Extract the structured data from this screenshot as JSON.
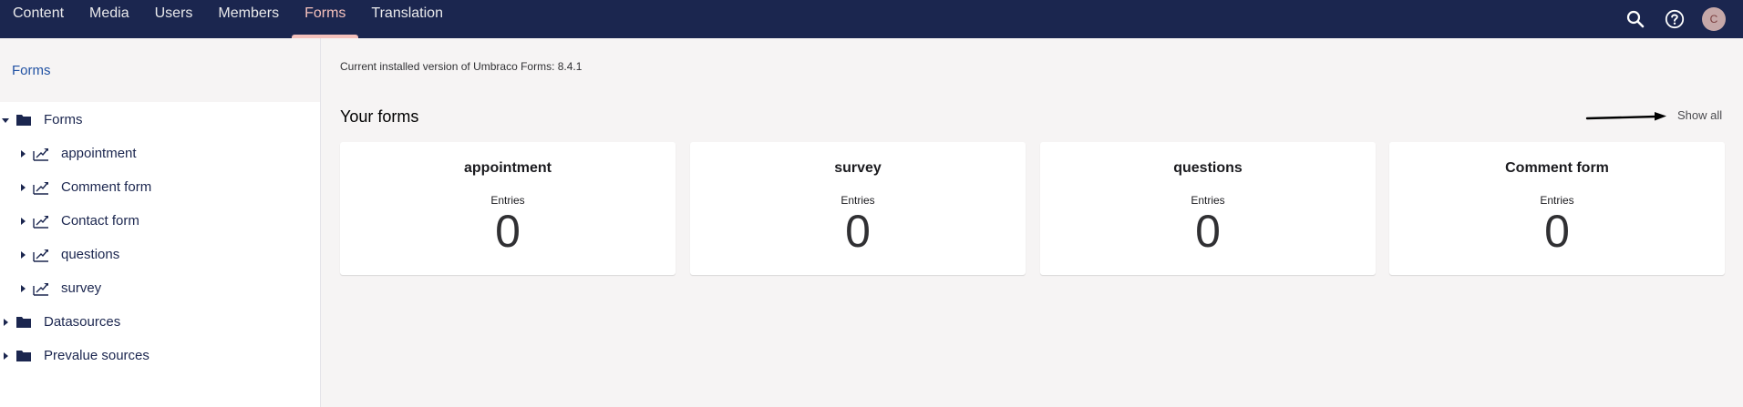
{
  "nav": {
    "items": [
      {
        "label": "Content",
        "active": false
      },
      {
        "label": "Media",
        "active": false
      },
      {
        "label": "Users",
        "active": false
      },
      {
        "label": "Members",
        "active": false
      },
      {
        "label": "Forms",
        "active": true
      },
      {
        "label": "Translation",
        "active": false
      }
    ],
    "avatar_initial": "C",
    "icons": [
      "search-icon",
      "help-icon"
    ]
  },
  "sidebar": {
    "title": "Forms",
    "tree": [
      {
        "label": "Forms",
        "icon": "folder-icon",
        "expanded": true,
        "level": 0
      },
      {
        "label": "appointment",
        "icon": "form-icon",
        "expanded": false,
        "level": 1
      },
      {
        "label": "Comment form",
        "icon": "form-icon",
        "expanded": false,
        "level": 1
      },
      {
        "label": "Contact form",
        "icon": "form-icon",
        "expanded": false,
        "level": 1
      },
      {
        "label": "questions",
        "icon": "form-icon",
        "expanded": false,
        "level": 1
      },
      {
        "label": "survey",
        "icon": "form-icon",
        "expanded": false,
        "level": 1
      },
      {
        "label": "Datasources",
        "icon": "folder-icon",
        "expanded": false,
        "level": 0
      },
      {
        "label": "Prevalue sources",
        "icon": "folder-icon",
        "expanded": false,
        "level": 0
      }
    ]
  },
  "main": {
    "version_text": "Current installed version of Umbraco Forms: 8.4.1",
    "section_title": "Your forms",
    "show_all_label": "Show all",
    "cards": [
      {
        "name": "appointment",
        "entries_label": "Entries",
        "entries": "0"
      },
      {
        "name": "survey",
        "entries_label": "Entries",
        "entries": "0"
      },
      {
        "name": "questions",
        "entries_label": "Entries",
        "entries": "0"
      },
      {
        "name": "Comment form",
        "entries_label": "Entries",
        "entries": "0"
      }
    ]
  },
  "colors": {
    "topbar": "#1b264f",
    "active_nav": "#f5c1bc",
    "sidebar_title": "#2152a3",
    "background": "#f6f4f4"
  }
}
